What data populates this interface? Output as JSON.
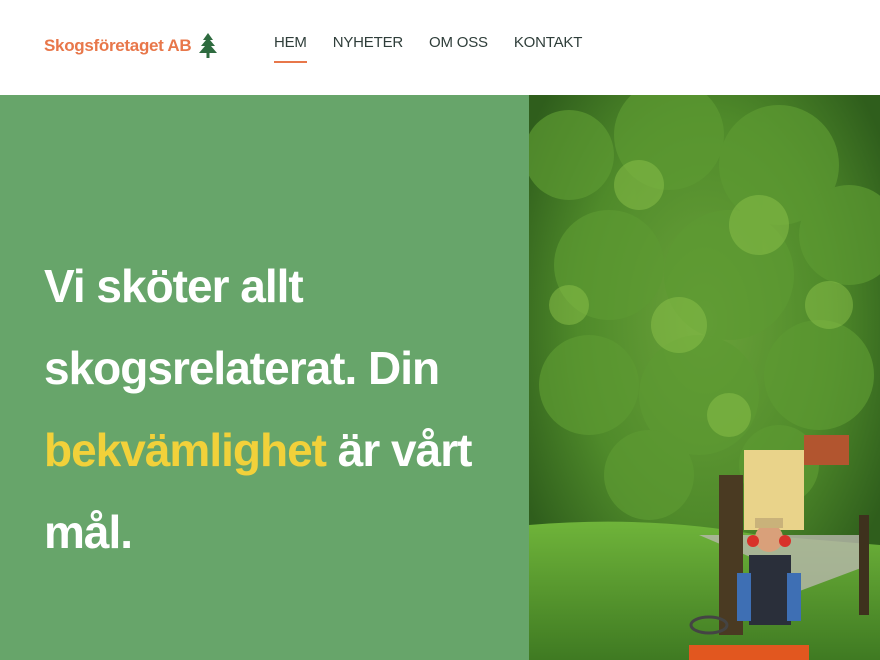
{
  "brand": {
    "name": "Skogsföretaget AB",
    "logo_icon": "pine-tree-icon",
    "color": "#e8774a"
  },
  "nav": {
    "items": [
      {
        "label": "HEM",
        "active": true
      },
      {
        "label": "NYHETER",
        "active": false
      },
      {
        "label": "OM OSS",
        "active": false
      },
      {
        "label": "KONTAKT",
        "active": false
      }
    ]
  },
  "hero": {
    "title_part1": "Vi sköter allt skogsrelaterat. Din",
    "title_highlight": "bekvämlighet",
    "title_part2": "är vårt mål.",
    "bg_color": "#67a56a",
    "highlight_color": "#f2d13a",
    "image": "photo-man-on-ride-on-mower-under-tree"
  }
}
